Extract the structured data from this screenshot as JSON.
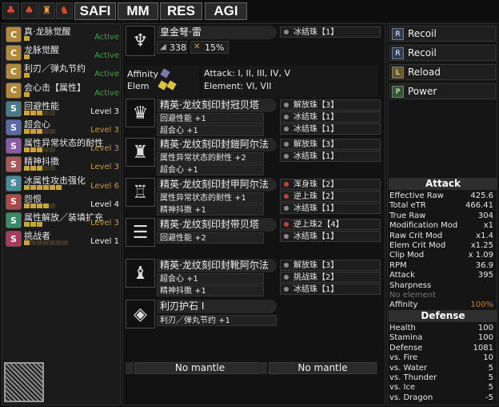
{
  "topbar": {
    "icons": [
      "hunter-icon",
      "armor-icon",
      "armor-icon",
      "armor-icon"
    ],
    "tabs": [
      "SAFI",
      "MM",
      "RES",
      "AGI"
    ]
  },
  "skills": [
    {
      "name": "真·龙脉觉醒",
      "pips": 1,
      "max": 1,
      "level": "Active",
      "color": "#3fa63f",
      "icon": "C",
      "iconcolor": "#b08a3a"
    },
    {
      "name": "龙脉觉醒",
      "pips": 1,
      "max": 1,
      "level": "Active",
      "color": "#3fa63f",
      "icon": "C",
      "iconcolor": "#b08a3a"
    },
    {
      "name": "利刃／弹丸节约",
      "pips": 1,
      "max": 1,
      "level": "Active",
      "color": "#3fa63f",
      "icon": "C",
      "iconcolor": "#b08a3a"
    },
    {
      "name": "会心击【属性】",
      "pips": 1,
      "max": 1,
      "level": "Active",
      "color": "#3fa63f",
      "icon": "C",
      "iconcolor": "#b08a3a"
    },
    {
      "name": "回避性能",
      "pips": 3,
      "max": 5,
      "level": "Level 3",
      "color": "#f0f0f0",
      "icon": "S",
      "iconcolor": "#4a7a8a"
    },
    {
      "name": "超会心",
      "pips": 3,
      "max": 5,
      "level": "Level 3",
      "color": "#c89a3a",
      "icon": "S",
      "iconcolor": "#5a6aa8"
    },
    {
      "name": "属性异常状态的耐性",
      "pips": 3,
      "max": 5,
      "level": "Level 3",
      "color": "#c89a3a",
      "icon": "S",
      "iconcolor": "#8a5aa8"
    },
    {
      "name": "精神抖擞",
      "pips": 3,
      "max": 5,
      "level": "Level 3",
      "color": "#c89a3a",
      "icon": "S",
      "iconcolor": "#a85a5a"
    },
    {
      "name": "冰属性攻击强化",
      "pips": 6,
      "max": 6,
      "level": "Level 6",
      "color": "#c89a3a",
      "icon": "S",
      "iconcolor": "#4a8a9a"
    },
    {
      "name": "怨恨",
      "pips": 4,
      "max": 5,
      "level": "Level 4",
      "color": "#f0f0f0",
      "icon": "S",
      "iconcolor": "#a84a4a"
    },
    {
      "name": "属性解放／装填扩充",
      "pips": 3,
      "max": 3,
      "level": "Level 3",
      "color": "#c89a3a",
      "icon": "S",
      "iconcolor": "#3a8a6a"
    },
    {
      "name": "挑战者",
      "pips": 1,
      "max": 7,
      "level": "Level 1",
      "color": "#f0f0f0",
      "icon": "S",
      "iconcolor": "#a83a5a"
    }
  ],
  "weapon": {
    "name": "皇金弩·雷",
    "stat1": "338",
    "stat2": "15%",
    "deco": "冰结珠【1】"
  },
  "weapon_info": {
    "affinity_label": "Affinity",
    "elem_label": "Elem",
    "attack": "Attack:  I, II, III, IV, V",
    "element": "Element: VI, VII"
  },
  "armor": [
    {
      "name": "精英·龙纹刻印封冠贝塔",
      "skills": [
        "回避性能 +1",
        "超会心 +1"
      ],
      "decos": [
        "解放珠【3】",
        "冰结珠【1】",
        "冰结珠【1】"
      ]
    },
    {
      "name": "精英·龙纹刻印封鎧阿尔法",
      "skills": [
        "属性异常状态的耐性 +2",
        "超会心 +1"
      ],
      "decos": [
        "解放珠【3】",
        "冰结珠【1】"
      ]
    },
    {
      "name": "精英·龙纹刻印封甲阿尔法",
      "skills": [
        "属性异常状态的耐性 +1",
        "精神抖擞 +1"
      ],
      "decos": [
        "浑身珠【2】",
        "逆上珠【2】",
        "冰结珠【1】"
      ]
    },
    {
      "name": "精英·龙纹刻印封带贝塔",
      "skills": [
        "回避性能 +2"
      ],
      "decos": [
        "逆上珠2【4】",
        "冰结珠【1】"
      ]
    },
    {
      "name": "精英·龙纹刻印封靴阿尔法",
      "skills": [
        "超会心 +1",
        "精神抖擞 +1"
      ],
      "decos": [
        "解放珠【3】",
        "挑战珠【2】",
        "冰结珠【1】"
      ]
    }
  ],
  "charm": {
    "name": "利刃护石 I",
    "skill": "利刃／弹丸节约 +1"
  },
  "mantles": [
    "No mantle",
    "No mantle"
  ],
  "actions": [
    "Recoil",
    "Recoil",
    "Reload",
    "Power"
  ],
  "attack_stats": {
    "title": "Attack",
    "rows": [
      {
        "k": "Effective Raw",
        "v": "425.6"
      },
      {
        "k": "Total eTR",
        "v": "466.41"
      },
      {
        "k": "True Raw",
        "v": "304"
      },
      {
        "k": "Modification Mod",
        "v": "x1"
      },
      {
        "k": "Raw Crit Mod",
        "v": "x1.4"
      },
      {
        "k": "Elem Crit Mod",
        "v": "x1.25"
      },
      {
        "k": "Clip Mod",
        "v": "x 1.09"
      },
      {
        "k": "RPM",
        "v": "36.9"
      },
      {
        "k": "Attack",
        "v": "395"
      },
      {
        "k": "Sharpness",
        "v": ""
      },
      {
        "k": "No element",
        "v": ""
      },
      {
        "k": "Affinity",
        "v": "100%"
      }
    ]
  },
  "defense_stats": {
    "title": "Defense",
    "rows": [
      {
        "k": "Health",
        "v": "100"
      },
      {
        "k": "Stamina",
        "v": "100"
      },
      {
        "k": "Defense",
        "v": "1081"
      },
      {
        "k": "vs. Fire",
        "v": "10"
      },
      {
        "k": "vs. Water",
        "v": "5"
      },
      {
        "k": "vs. Thunder",
        "v": "5"
      },
      {
        "k": "vs. Ice",
        "v": "5"
      },
      {
        "k": "vs. Dragon",
        "v": "-5"
      }
    ]
  }
}
